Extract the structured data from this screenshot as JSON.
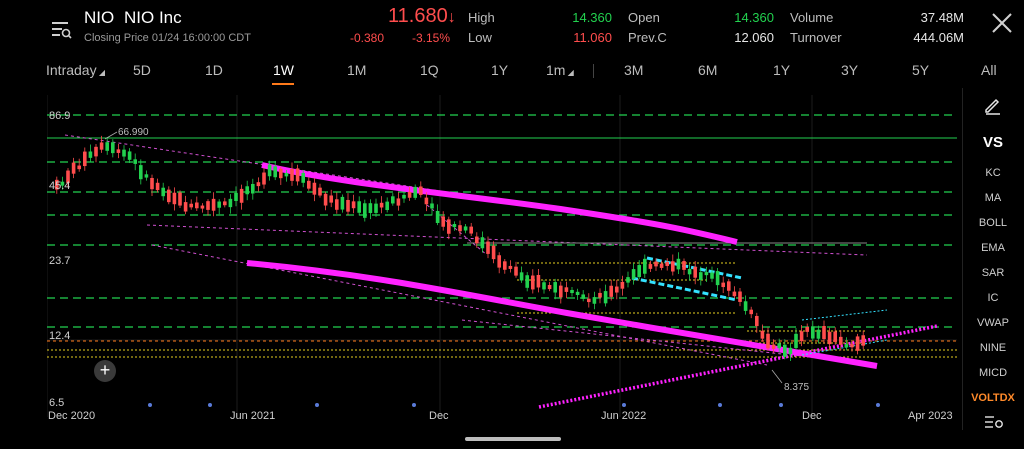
{
  "header": {
    "symbol": "NIO",
    "company": "NIO Inc",
    "closing_price": "Closing Price  01/24 16:00:00 CDT",
    "price": "11.680",
    "price_arrow": "↓",
    "change": "-0.380",
    "change_pct": "-3.15%",
    "high_label": "High",
    "high_value": "14.360",
    "low_label": "Low",
    "low_value": "11.060",
    "open_label": "Open",
    "open_value": "14.360",
    "prevc_label": "Prev.C",
    "prevc_value": "12.060",
    "volume_label": "Volume",
    "volume_value": "37.48M",
    "turnover_label": "Turnover",
    "turnover_value": "444.06M"
  },
  "tabs": {
    "intraday": "Intraday",
    "d5": "5D",
    "d1": "1D",
    "w1": "1W",
    "m1": "1M",
    "q1": "1Q",
    "y1": "1Y",
    "min": "1m",
    "m3": "3M",
    "m6": "6M",
    "y1b": "1Y",
    "y3": "3Y",
    "y5": "5Y",
    "all": "All"
  },
  "chart": {
    "y_labels": [
      "86.9",
      "45.4",
      "23.7",
      "12.4",
      "6.5"
    ],
    "x_labels": [
      "Dec 2020",
      "Jun 2021",
      "Dec",
      "Jun 2022",
      "Dec",
      "Apr 2023"
    ],
    "max_annotation": "66.990",
    "min_annotation": "8.375"
  },
  "indicators": {
    "vs": "VS",
    "kc": "KC",
    "ma": "MA",
    "boll": "BOLL",
    "ema": "EMA",
    "sar": "SAR",
    "ic": "IC",
    "vwap": "VWAP",
    "nine": "NINE",
    "micd": "MICD",
    "voltdx": "VOLTDX"
  },
  "colors": {
    "up": "#22d14f",
    "down": "#ff4d4d",
    "accent": "#ff7a1a",
    "trend_channel": "#ff22ff",
    "flag_lines": "#34e2ff",
    "grid_green": "#22d14f"
  },
  "icons": {
    "menu": "list-search-icon",
    "close": "close-icon",
    "pen": "pen-icon",
    "settings": "settings-icon",
    "plus": "plus-icon"
  }
}
